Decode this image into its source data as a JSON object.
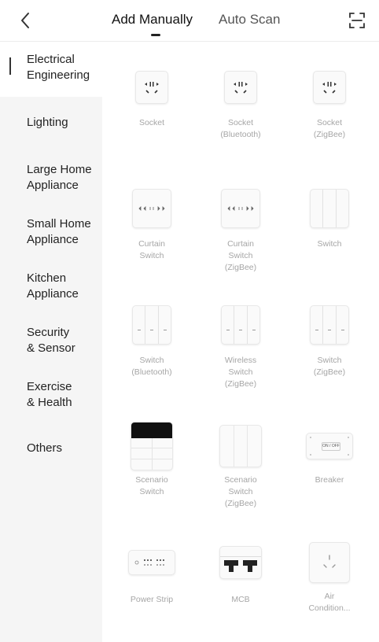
{
  "header": {
    "back_icon": "chevron-left-icon",
    "tabs": [
      {
        "label": "Add Manually",
        "active": true
      },
      {
        "label": "Auto Scan",
        "active": false
      }
    ],
    "scan_icon": "scan-frame-icon"
  },
  "sidebar": {
    "items": [
      {
        "label": "Electrical\nEngineering",
        "active": true
      },
      {
        "label": "Lighting"
      },
      {
        "label": "Large Home\nAppliance"
      },
      {
        "label": "Small Home\nAppliance"
      },
      {
        "label": "Kitchen\nAppliance"
      },
      {
        "label": "Security\n& Sensor"
      },
      {
        "label": "Exercise\n& Health"
      },
      {
        "label": "Others"
      }
    ]
  },
  "devices": [
    {
      "name": "Socket",
      "icon": "socket-icon"
    },
    {
      "name": "Socket\n(Bluetooth)",
      "icon": "socket-icon"
    },
    {
      "name": "Socket\n(ZigBee)",
      "icon": "socket-icon"
    },
    {
      "name": "Curtain\nSwitch",
      "icon": "curtain-switch-icon"
    },
    {
      "name": "Curtain\nSwitch\n(ZigBee)",
      "icon": "curtain-switch-icon"
    },
    {
      "name": "Switch",
      "icon": "switch-icon"
    },
    {
      "name": "Switch\n(Bluetooth)",
      "icon": "triple-switch-icon"
    },
    {
      "name": "Wireless\nSwitch\n(ZigBee)",
      "icon": "triple-switch-icon"
    },
    {
      "name": "Switch\n(ZigBee)",
      "icon": "triple-switch-icon"
    },
    {
      "name": "Scenario\nSwitch",
      "icon": "scenario-switch-icon"
    },
    {
      "name": "Scenario\nSwitch\n(ZigBee)",
      "icon": "scenario-switch-zigbee-icon"
    },
    {
      "name": "Breaker",
      "icon": "breaker-icon"
    },
    {
      "name": "Power Strip",
      "icon": "power-strip-icon"
    },
    {
      "name": "MCB",
      "icon": "mcb-icon"
    },
    {
      "name": "Air\nCondition...",
      "icon": "ac-socket-icon"
    }
  ],
  "device_text": {
    "breaker_label": "ON / OFF"
  }
}
